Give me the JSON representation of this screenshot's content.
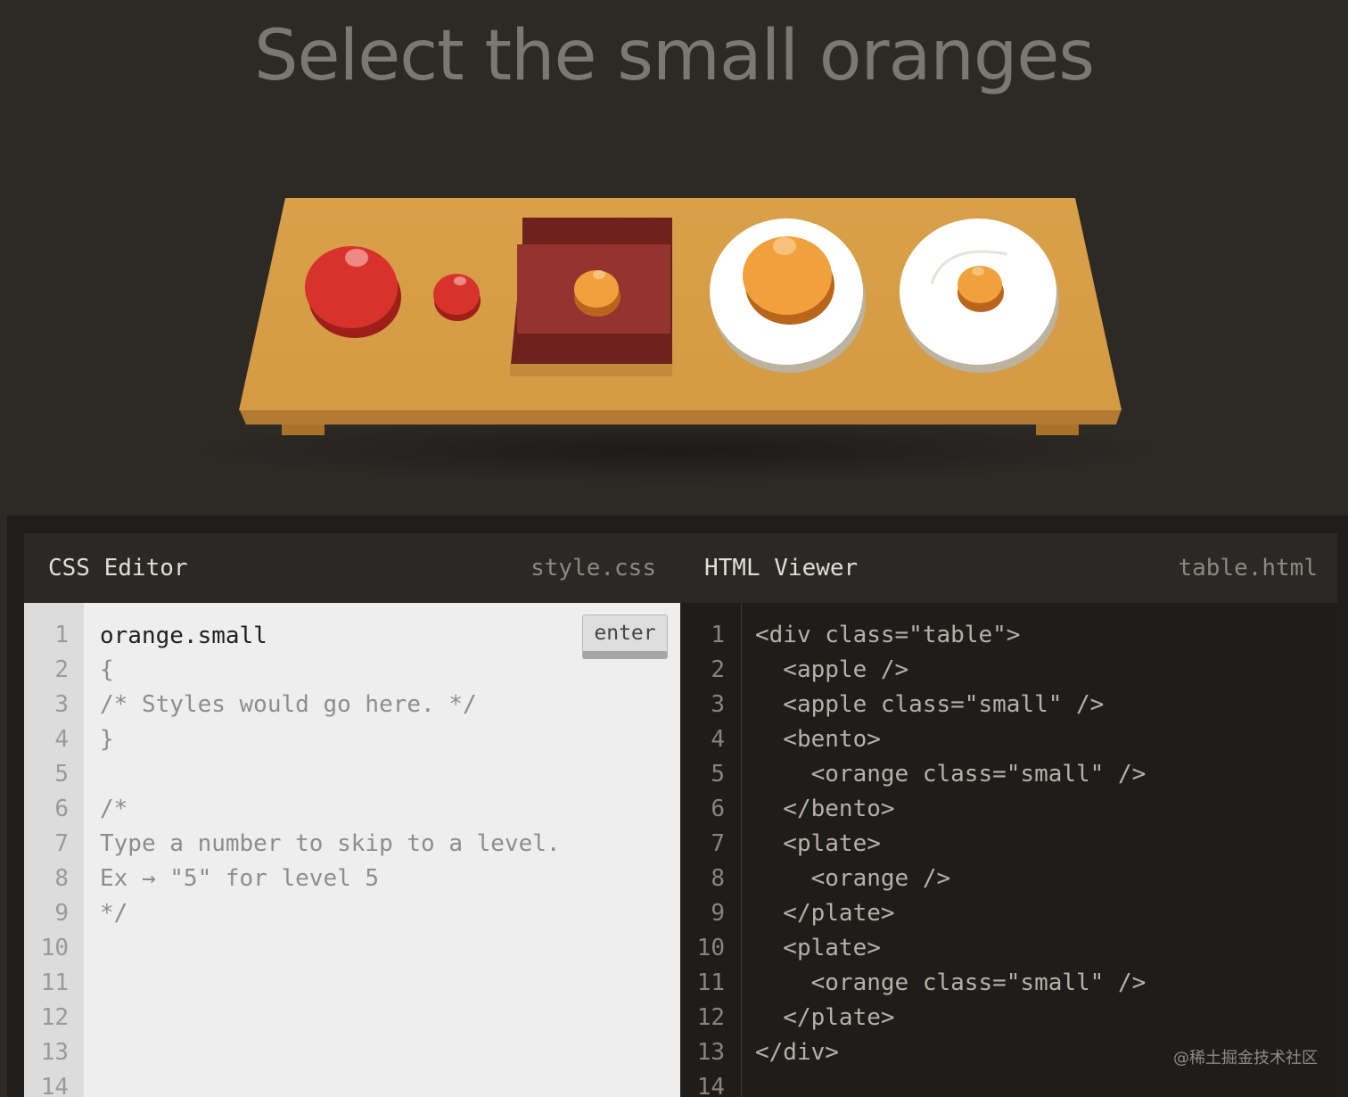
{
  "level_title": "Select the small oranges",
  "table_items": [
    {
      "type": "apple",
      "class": ""
    },
    {
      "type": "apple",
      "class": "small"
    },
    {
      "type": "bento",
      "child": {
        "type": "orange",
        "class": "small"
      }
    },
    {
      "type": "plate",
      "child": {
        "type": "orange",
        "class": ""
      }
    },
    {
      "type": "plate",
      "child": {
        "type": "orange",
        "class": "small"
      }
    }
  ],
  "colors": {
    "background": "#2d2a26",
    "table": "#d9a04a",
    "apple": "#d7332c",
    "orange": "#f0a13c",
    "bento": "#7b2623",
    "plate": "#ffffff"
  },
  "css_editor": {
    "title": "CSS Editor",
    "filename": "style.css",
    "input_value": "orange.small",
    "enter_label": "enter",
    "line_numbers": [
      "1",
      "2",
      "3",
      "4",
      "5",
      "6",
      "7",
      "8",
      "9",
      "10",
      "11",
      "12",
      "13",
      "14"
    ],
    "lines": [
      "{",
      "/* Styles would go here. */",
      "}",
      "",
      "/*",
      "Type a number to skip to a level.",
      "Ex → \"5\" for level 5",
      "*/"
    ]
  },
  "html_viewer": {
    "title": "HTML Viewer",
    "filename": "table.html",
    "line_numbers": [
      "1",
      "2",
      "3",
      "4",
      "5",
      "6",
      "7",
      "8",
      "9",
      "10",
      "11",
      "12",
      "13",
      "14"
    ],
    "lines": [
      "<div class=\"table\">",
      "  <apple />",
      "  <apple class=\"small\" />",
      "  <bento>",
      "    <orange class=\"small\" />",
      "  </bento>",
      "  <plate>",
      "    <orange />",
      "  </plate>",
      "  <plate>",
      "    <orange class=\"small\" />",
      "  </plate>",
      "</div>"
    ]
  },
  "watermark": "@稀土掘金技术社区"
}
